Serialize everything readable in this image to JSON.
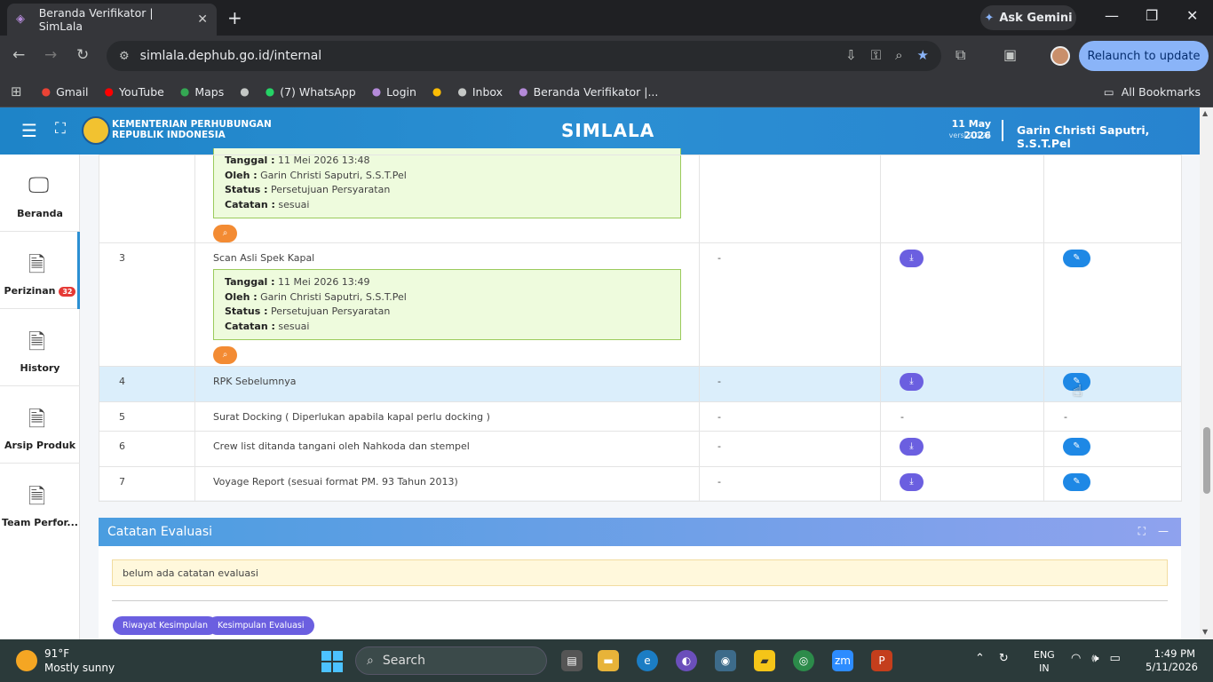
{
  "browser": {
    "tab_title": "Beranda Verifikator | SimLala",
    "ask_gemini": "Ask Gemini",
    "url": "simlala.dephub.go.id/internal",
    "relaunch": "Relaunch to update",
    "bookmarks": [
      {
        "label": "Gmail",
        "icon": "gmail-icon",
        "color": "#ea4335"
      },
      {
        "label": "YouTube",
        "icon": "youtube-icon",
        "color": "#ff0000"
      },
      {
        "label": "Maps",
        "icon": "maps-icon",
        "color": "#34a853"
      },
      {
        "label": "",
        "icon": "globe-icon",
        "color": "#c4c7c5"
      },
      {
        "label": "(7) WhatsApp",
        "icon": "whatsapp-icon",
        "color": "#25d366"
      },
      {
        "label": "Login",
        "icon": "login-icon",
        "color": "#b48ad9"
      },
      {
        "label": "",
        "icon": "pinwheel-icon",
        "color": "#fbbc04"
      },
      {
        "label": "Inbox",
        "icon": "mail-icon",
        "color": "#c4c7c5"
      },
      {
        "label": "Beranda Verifikator |...",
        "icon": "simlala-icon",
        "color": "#b48ad9"
      }
    ],
    "all_bookmarks": "All Bookmarks"
  },
  "header": {
    "ministry_line1": "KEMENTERIAN PERHUBUNGAN",
    "ministry_line2": "REPUBLIK INDONESIA",
    "title": "SIMLALA",
    "date": "11 May 2026",
    "version": "versi 2.0.24",
    "user": "Garin Christi Saputri, S.S.T.Pel"
  },
  "sidebar": {
    "items": [
      {
        "label": "Beranda",
        "icon": "monitor-icon"
      },
      {
        "label": "Perizinan",
        "icon": "document-icon",
        "badge": "32"
      },
      {
        "label": "History",
        "icon": "document-icon"
      },
      {
        "label": "Arsip Produk",
        "icon": "document-icon"
      },
      {
        "label": "Team Perfor...",
        "icon": "document-icon"
      }
    ]
  },
  "table": {
    "rows": [
      {
        "no": "",
        "doc": "",
        "info": {
          "tanggal_label": "Tanggal :",
          "tanggal": "11 Mei 2026 13:48",
          "oleh_label": "Oleh :",
          "oleh": "Garin Christi Saputri, S.S.T.Pel",
          "status_label": "Status :",
          "status": "Persetujuan Persyaratan",
          "catatan_label": "Catatan :",
          "catatan": "sesuai"
        },
        "ket": "",
        "download": false,
        "edit": false
      },
      {
        "no": "3",
        "doc": "Scan Asli Spek Kapal",
        "info": {
          "tanggal_label": "Tanggal :",
          "tanggal": "11 Mei 2026 13:49",
          "oleh_label": "Oleh :",
          "oleh": "Garin Christi Saputri, S.S.T.Pel",
          "status_label": "Status :",
          "status": "Persetujuan Persyaratan",
          "catatan_label": "Catatan :",
          "catatan": "sesuai"
        },
        "ket": "-",
        "download": true,
        "edit": true
      },
      {
        "no": "4",
        "doc": "RPK Sebelumnya",
        "ket": "-",
        "download": true,
        "edit": true
      },
      {
        "no": "5",
        "doc": "Surat Docking ( Diperlukan apabila kapal perlu docking )",
        "ket": "-",
        "download_text": "-",
        "edit_text": "-"
      },
      {
        "no": "6",
        "doc": "Crew list ditanda tangani oleh Nahkoda dan stempel",
        "ket": "-",
        "download": true,
        "edit": true
      },
      {
        "no": "7",
        "doc": "Voyage Report (sesuai format PM. 93 Tahun 2013)",
        "ket": "-",
        "download": true,
        "edit": true
      }
    ]
  },
  "evaluasi": {
    "title": "Catatan Evaluasi",
    "note": "belum ada catatan evaluasi",
    "btn_riwayat": "Riwayat Kesimpulan",
    "btn_kesimpulan": "Kesimpulan Evaluasi"
  },
  "taskbar": {
    "temp": "91°F",
    "weather": "Mostly sunny",
    "search": "Search",
    "lang1": "ENG",
    "lang2": "IN",
    "time": "1:49 PM",
    "date": "5/11/2026"
  },
  "colors": {
    "header": "#2b8fd3",
    "download_btn": "#6b5fe0",
    "edit_btn": "#1e88e5",
    "zoom_btn": "#f38b33",
    "approved_box": "#eefbdd"
  }
}
